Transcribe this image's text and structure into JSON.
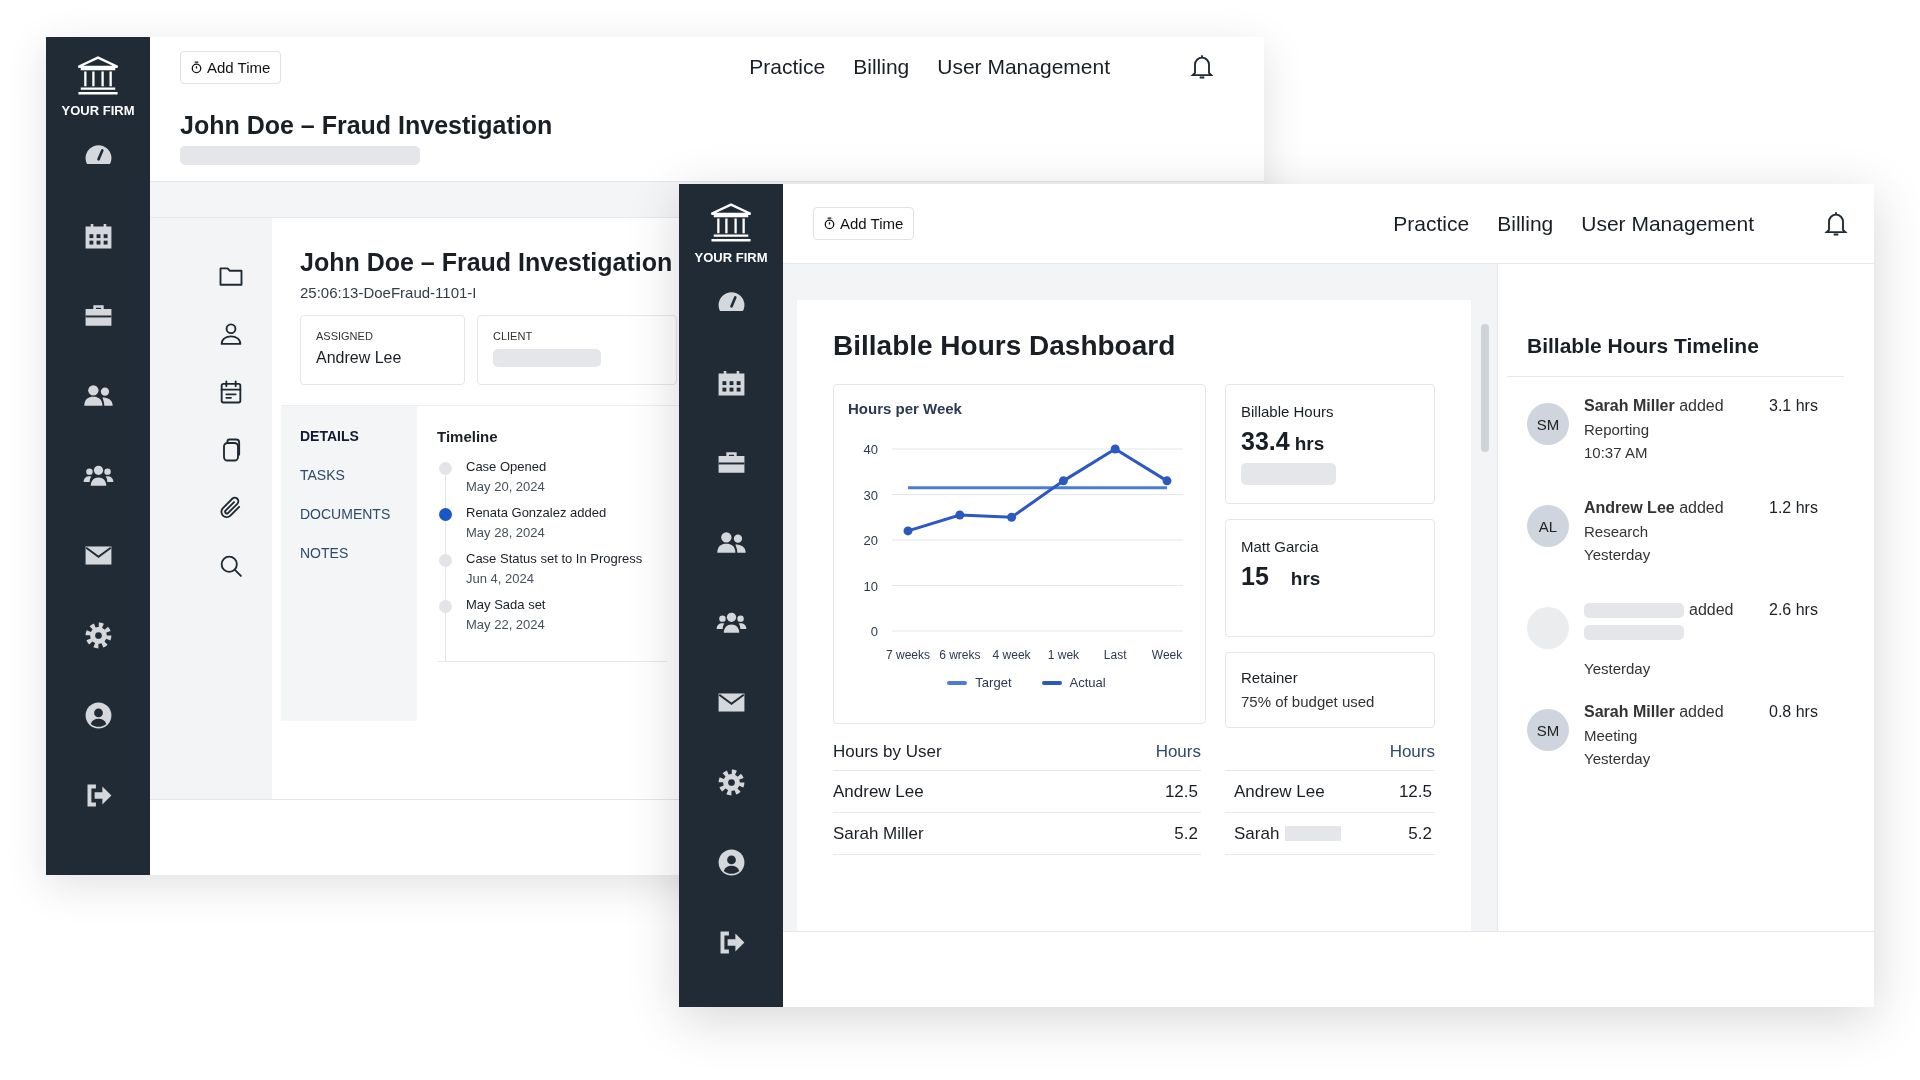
{
  "case_window": {
    "brand": "YOUR FIRM",
    "add_time_button": "Add Time",
    "nav": [
      "Practice",
      "Billing",
      "User Management"
    ],
    "page_title": "John Doe – Fraud Investigation",
    "case": {
      "title": "John Doe – Fraud Investigation",
      "case_id": "25:06:13-DoeFraud-1101-I",
      "fields": [
        {
          "label": "ASSIGNED",
          "value": "Andrew Lee",
          "redacted": false
        },
        {
          "label": "CLIENT",
          "redacted": true
        }
      ]
    },
    "tabs": [
      {
        "label": "DETAILS",
        "selected": true
      },
      {
        "label": "TASKS",
        "selected": false
      },
      {
        "label": "DOCUMENTS",
        "selected": false
      },
      {
        "label": "NOTES",
        "selected": false
      }
    ],
    "timeline": {
      "title": "Timeline",
      "events": [
        {
          "title": "Case Opened",
          "date": "May 20, 2024",
          "highlighted": false
        },
        {
          "title": "Renata Gonzalez added",
          "date": "May 28, 2024",
          "highlighted": true
        },
        {
          "title": "Case Status set to In Progress",
          "date": "Jun 4, 2024",
          "highlighted": false
        },
        {
          "title": "May Sada set",
          "date": "May 22, 2024",
          "highlighted": false
        }
      ]
    }
  },
  "dashboard_window": {
    "brand": "YOUR FIRM",
    "add_time_button": "Add Time",
    "nav": [
      "Practice",
      "Billing",
      "User Management"
    ],
    "title": "Billable Hours Dashboard",
    "chart": {
      "title": "Hours per Week",
      "chart_data": {
        "type": "line",
        "grid": true,
        "categories": [
          "7 weeks",
          "6 wreks",
          "4 week",
          "1 wek",
          "Last",
          "Week"
        ],
        "ylim": [
          0,
          40
        ],
        "yticks": [
          0,
          10,
          20,
          30,
          40
        ],
        "series": [
          {
            "name": "Target",
            "color": "#4d7cd8",
            "values": [
              31.5,
              31.5,
              31.5,
              31.5,
              31.5,
              31.5
            ],
            "marker": false
          },
          {
            "name": "Actual",
            "color": "#2c59c0",
            "values": [
              22,
              25.5,
              25,
              33,
              40,
              33
            ],
            "marker": true
          }
        ]
      }
    },
    "stats": [
      {
        "kind": "metric",
        "label": "Billable Hours",
        "value": "33.4",
        "unit": "hrs",
        "pending": true
      },
      {
        "kind": "metric",
        "label": "Matt Garcia",
        "value": "15",
        "unit": "hrs",
        "pending": false
      },
      {
        "kind": "note",
        "label": "Retainer",
        "text": "75% of budget used"
      }
    ],
    "tables": [
      {
        "title": "Hours by User",
        "column": "Hours",
        "rows": [
          {
            "name": "Andrew Lee",
            "hours": "12.5",
            "redacted": false
          },
          {
            "name": "Sarah Miller",
            "hours": "5.2",
            "redacted": false
          }
        ]
      },
      {
        "column": "Hours",
        "rows": [
          {
            "name": "Andrew Lee",
            "hours": "12.5",
            "redacted": false
          },
          {
            "name": "Sarah",
            "hours": "5.2",
            "redacted": true
          }
        ]
      }
    ],
    "timeline": {
      "title": "Billable Hours Timeline",
      "entries": [
        {
          "initials": "SM",
          "headline": "**Sarah Miller** added",
          "task": "Reporting",
          "time": "10:37 AM",
          "hours": "3.1 hrs",
          "redacted": false
        },
        {
          "initials": "AL",
          "headline": "**Andrew Lee** added",
          "task": "Research",
          "time": "Yesterday",
          "hours": "1.2 hrs",
          "redacted": false
        },
        {
          "headline": "added",
          "time": "Yesterday",
          "hours": "2.6 hrs",
          "redacted": true
        },
        {
          "initials": "SM",
          "headline": "**Sarah Miller** added",
          "task": "Meeting",
          "time": "Yesterday",
          "hours": "0.8 hrs",
          "redacted": false
        }
      ]
    }
  }
}
